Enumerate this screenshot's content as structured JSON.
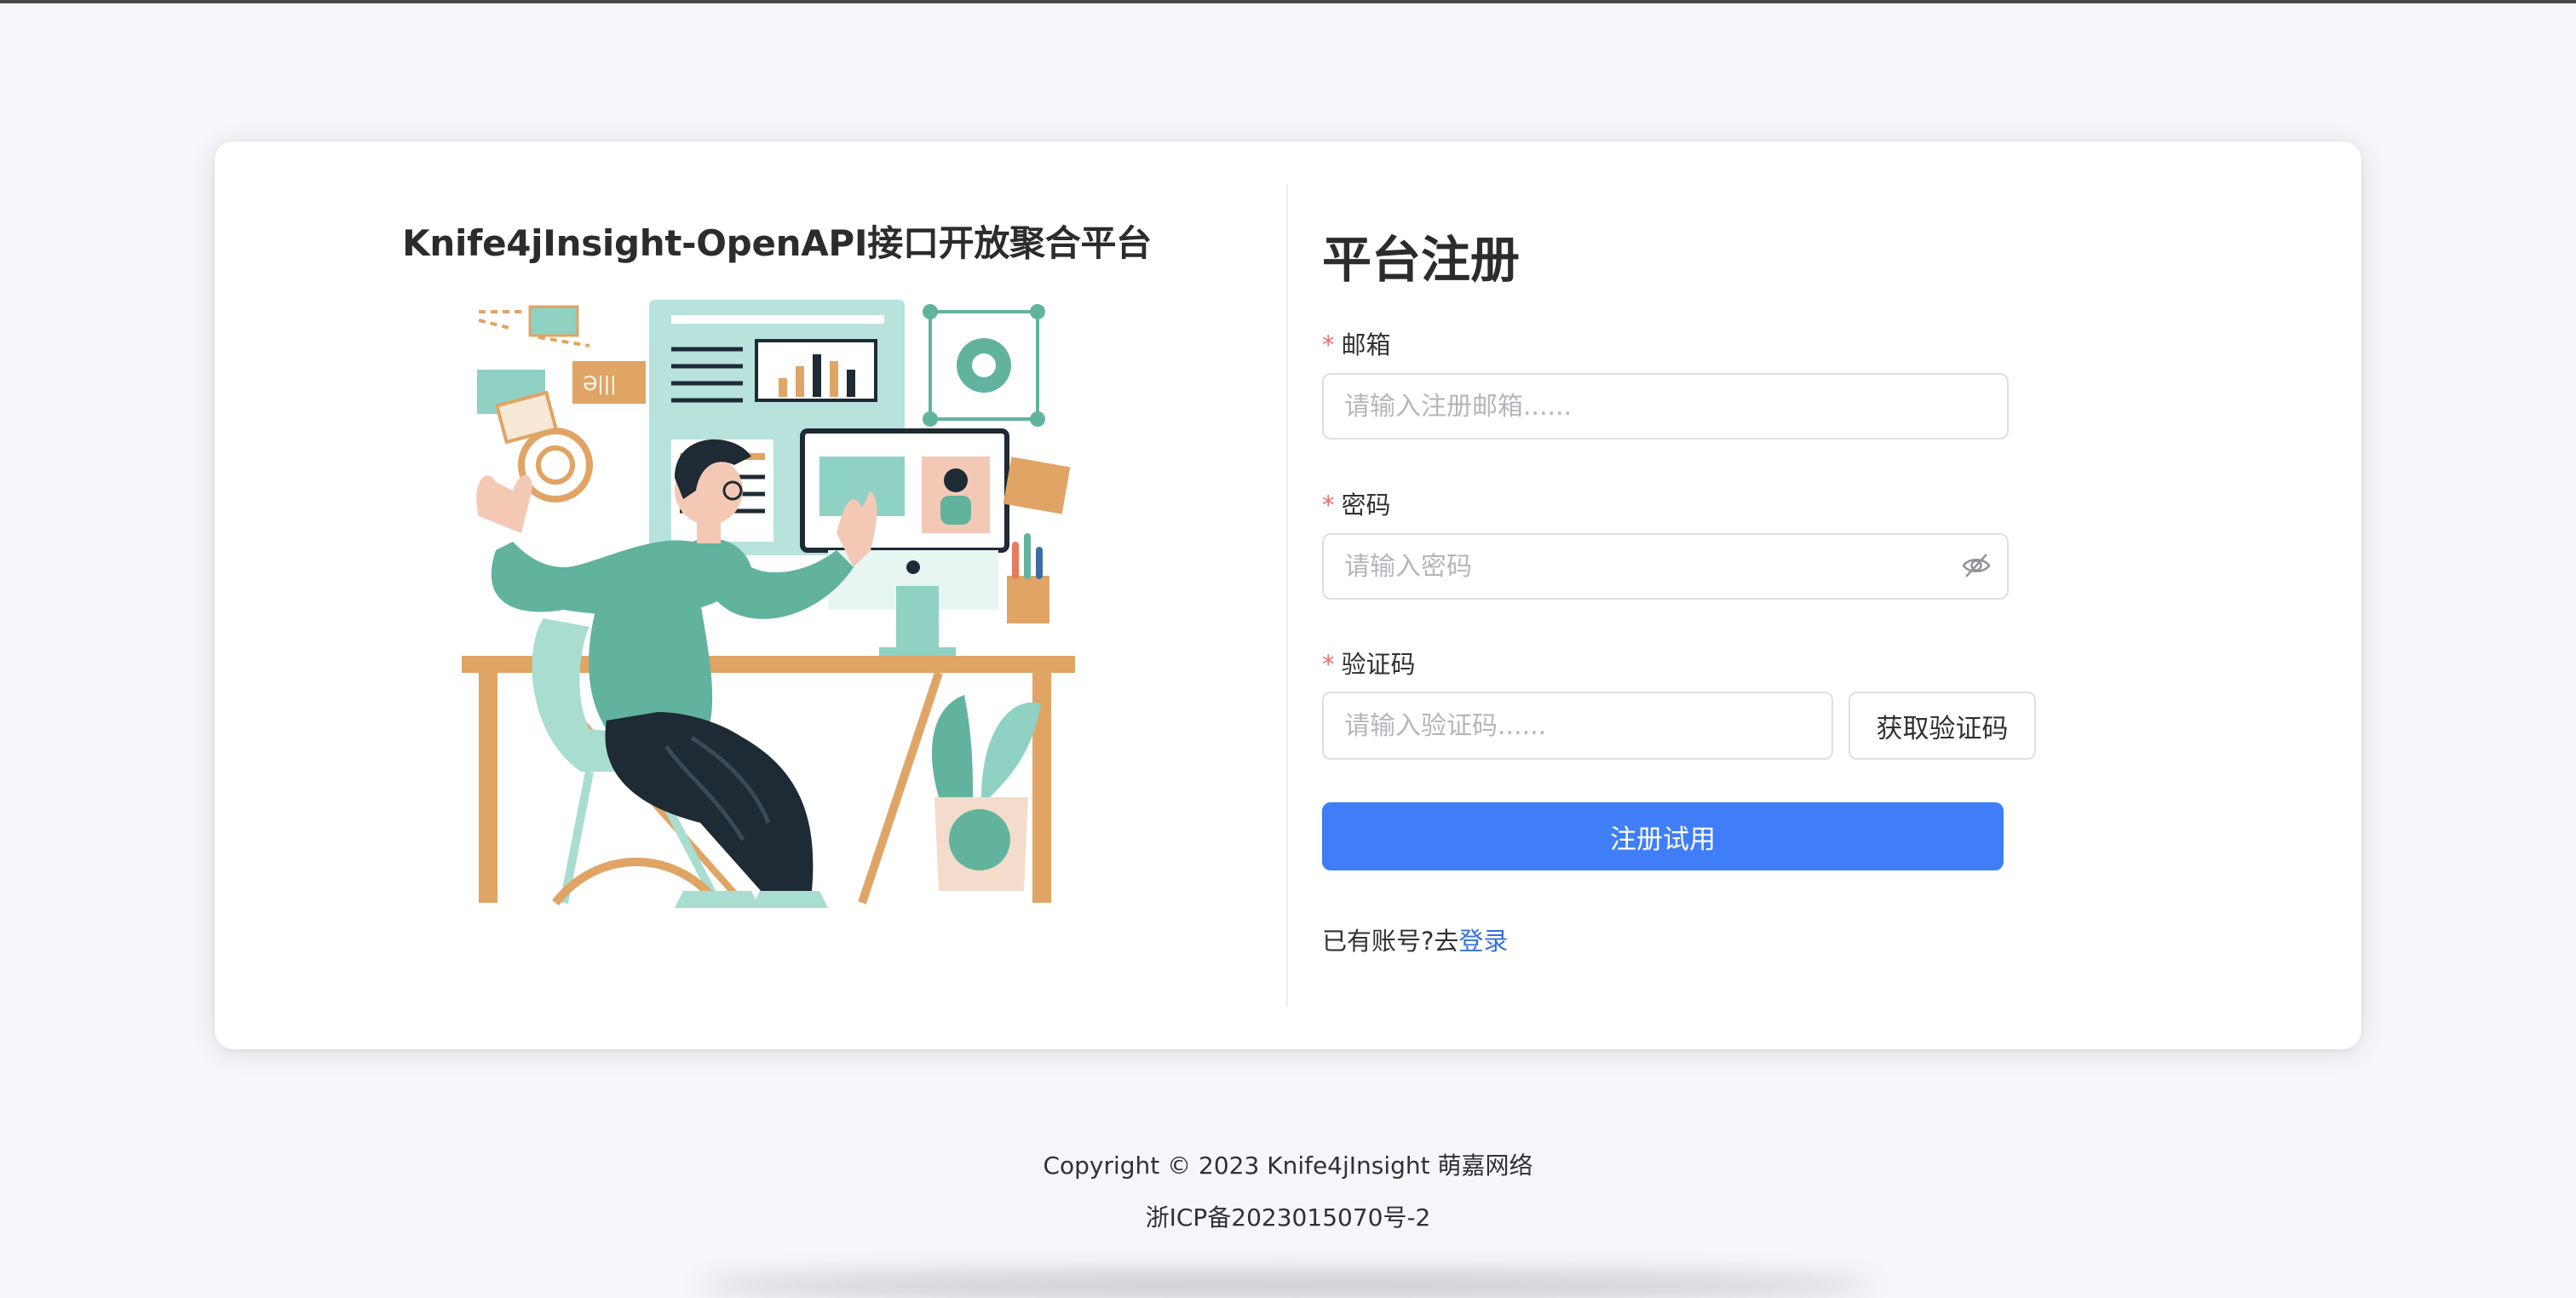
{
  "platform": {
    "title": "Knife4jInsight-OpenAPI接口开放聚合平台"
  },
  "form": {
    "heading": "平台注册",
    "required_mark": "*",
    "email": {
      "label": "邮箱",
      "placeholder": "请输入注册邮箱......",
      "value": ""
    },
    "password": {
      "label": "密码",
      "placeholder": "请输入密码",
      "value": "",
      "toggle_icon": "eye-off-icon"
    },
    "code": {
      "label": "验证码",
      "placeholder": "请输入验证码......",
      "value": "",
      "button_label": "获取验证码"
    },
    "submit_label": "注册试用",
    "login_prompt": "已有账号?去",
    "login_link": "登录"
  },
  "footer": {
    "copyright": "Copyright © 2023 Knife4jInsight 萌嘉网络",
    "icp": "浙ICP备2023015070号-2"
  },
  "colors": {
    "primary": "#3f7ef6",
    "link": "#3470e0",
    "required": "#f56c6c",
    "illustration_teal": "#62b39e",
    "illustration_orange": "#e0a465"
  }
}
